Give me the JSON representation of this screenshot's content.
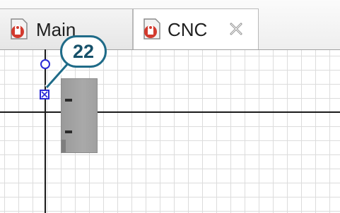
{
  "tabs": [
    {
      "label": "Main",
      "icon": "red-lock-document-icon",
      "active": false
    },
    {
      "label": "CNC",
      "icon": "red-lock-document-icon",
      "active": true,
      "close_icon": "close-x-icon"
    }
  ],
  "callout": {
    "label": "22"
  },
  "colors": {
    "callout_border": "#1f6b88",
    "port": "#2b2bd6",
    "block": "#a2a2a2",
    "grid": "#dcdcdc"
  }
}
